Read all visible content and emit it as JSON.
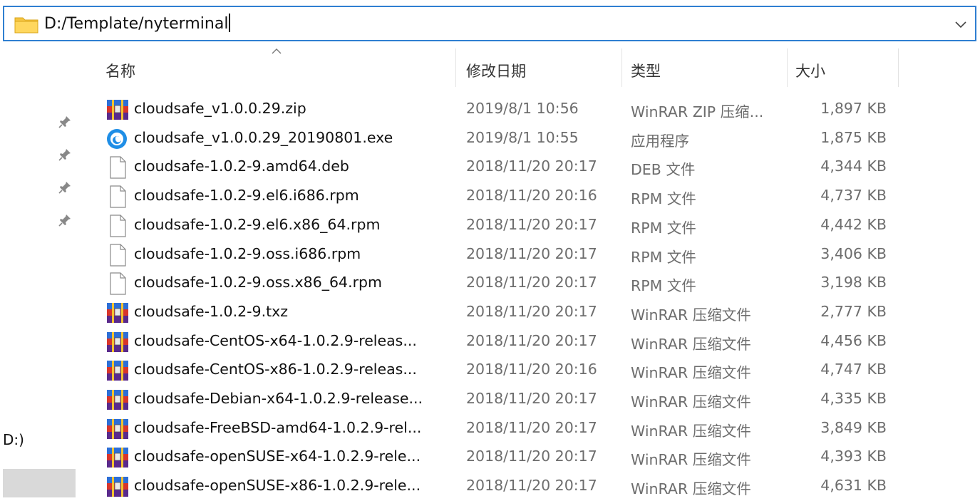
{
  "address_bar": {
    "path": "D:/Template/nyterminal",
    "folder_icon": "folder-icon",
    "dropdown_icon": "chevron-down-icon"
  },
  "nav_pane": {
    "drive_label": "D:)",
    "pin_icon": "pin-icon"
  },
  "columns": {
    "name": "名称",
    "date": "修改日期",
    "type": "类型",
    "size": "大小"
  },
  "files": [
    {
      "icon": "winrar-archive-icon",
      "name": "cloudsafe_v1.0.0.29.zip",
      "date": "2019/8/1 10:56",
      "type": "WinRAR ZIP 压缩...",
      "size": "1,897 KB"
    },
    {
      "icon": "app-exe-icon",
      "name": "cloudsafe_v1.0.0.29_20190801.exe",
      "date": "2019/8/1 10:55",
      "type": "应用程序",
      "size": "1,875 KB"
    },
    {
      "icon": "blank-file-icon",
      "name": "cloudsafe-1.0.2-9.amd64.deb",
      "date": "2018/11/20 20:17",
      "type": "DEB 文件",
      "size": "4,344 KB"
    },
    {
      "icon": "blank-file-icon",
      "name": "cloudsafe-1.0.2-9.el6.i686.rpm",
      "date": "2018/11/20 20:16",
      "type": "RPM 文件",
      "size": "4,737 KB"
    },
    {
      "icon": "blank-file-icon",
      "name": "cloudsafe-1.0.2-9.el6.x86_64.rpm",
      "date": "2018/11/20 20:17",
      "type": "RPM 文件",
      "size": "4,442 KB"
    },
    {
      "icon": "blank-file-icon",
      "name": "cloudsafe-1.0.2-9.oss.i686.rpm",
      "date": "2018/11/20 20:17",
      "type": "RPM 文件",
      "size": "3,406 KB"
    },
    {
      "icon": "blank-file-icon",
      "name": "cloudsafe-1.0.2-9.oss.x86_64.rpm",
      "date": "2018/11/20 20:17",
      "type": "RPM 文件",
      "size": "3,198 KB"
    },
    {
      "icon": "winrar-archive-icon",
      "name": "cloudsafe-1.0.2-9.txz",
      "date": "2018/11/20 20:17",
      "type": "WinRAR 压缩文件",
      "size": "2,777 KB"
    },
    {
      "icon": "winrar-archive-icon",
      "name": "cloudsafe-CentOS-x64-1.0.2.9-releas...",
      "date": "2018/11/20 20:17",
      "type": "WinRAR 压缩文件",
      "size": "4,456 KB"
    },
    {
      "icon": "winrar-archive-icon",
      "name": "cloudsafe-CentOS-x86-1.0.2.9-releas...",
      "date": "2018/11/20 20:16",
      "type": "WinRAR 压缩文件",
      "size": "4,747 KB"
    },
    {
      "icon": "winrar-archive-icon",
      "name": "cloudsafe-Debian-x64-1.0.2.9-release...",
      "date": "2018/11/20 20:17",
      "type": "WinRAR 压缩文件",
      "size": "4,335 KB"
    },
    {
      "icon": "winrar-archive-icon",
      "name": "cloudsafe-FreeBSD-amd64-1.0.2.9-rel...",
      "date": "2018/11/20 20:17",
      "type": "WinRAR 压缩文件",
      "size": "3,849 KB"
    },
    {
      "icon": "winrar-archive-icon",
      "name": "cloudsafe-openSUSE-x64-1.0.2.9-rele...",
      "date": "2018/11/20 20:17",
      "type": "WinRAR 压缩文件",
      "size": "4,393 KB"
    },
    {
      "icon": "winrar-archive-icon",
      "name": "cloudsafe-openSUSE-x86-1.0.2.9-rele...",
      "date": "2018/11/20 20:17",
      "type": "WinRAR 压缩文件",
      "size": "4,631 KB"
    }
  ],
  "colors": {
    "address_border": "#2f7fd1",
    "secondary_text": "#6d6d6d",
    "selected_nav": "#d9d9d9"
  }
}
